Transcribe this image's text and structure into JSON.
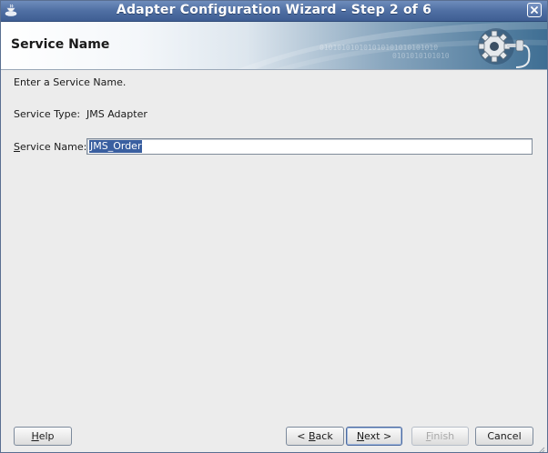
{
  "window": {
    "title": "Adapter Configuration Wizard - Step 2 of 6"
  },
  "header": {
    "title": "Service Name",
    "binary_line1": "010101010101010101010101010",
    "binary_line2": "0101010101010"
  },
  "content": {
    "instruction": "Enter a Service Name.",
    "service_type_label": "Service Type:",
    "service_type_value": "JMS Adapter",
    "service_name_label_mnemonic": "S",
    "service_name_label_rest": "ervice Name:",
    "service_name_value": "JMS_Order"
  },
  "buttons": {
    "help_mnemonic": "H",
    "help_rest": "elp",
    "back_prefix": "< ",
    "back_mnemonic": "B",
    "back_rest": "ack",
    "next_mnemonic": "N",
    "next_rest": "ext >",
    "finish_mnemonic": "F",
    "finish_rest": "inish",
    "cancel_label": "Cancel"
  },
  "icons": {
    "app": "coffee-cup-icon",
    "close": "close-icon",
    "logo": "gear-plug-icon",
    "resize": "resize-grip-icon"
  }
}
